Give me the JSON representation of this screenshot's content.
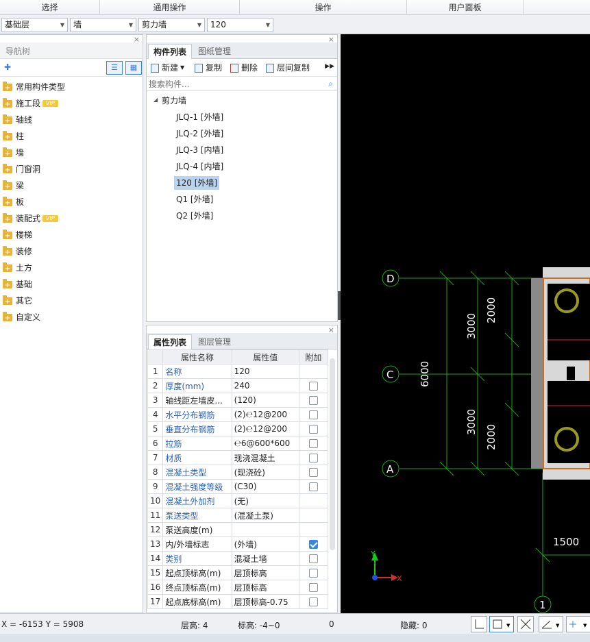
{
  "ribbon": [
    "选择",
    "通用操作",
    "操作",
    "用户面板"
  ],
  "selectors": {
    "floor": "基础层",
    "category": "墙",
    "type": "剪力墙",
    "component": "120"
  },
  "nav": {
    "title": "导航树",
    "items": [
      {
        "label": "常用构件类型",
        "vip": false
      },
      {
        "label": "施工段",
        "vip": true
      },
      {
        "label": "轴线",
        "vip": false
      },
      {
        "label": "柱",
        "vip": false
      },
      {
        "label": "墙",
        "vip": false
      },
      {
        "label": "门窗洞",
        "vip": false
      },
      {
        "label": "梁",
        "vip": false
      },
      {
        "label": "板",
        "vip": false
      },
      {
        "label": "装配式",
        "vip": true
      },
      {
        "label": "楼梯",
        "vip": false
      },
      {
        "label": "装修",
        "vip": false
      },
      {
        "label": "土方",
        "vip": false
      },
      {
        "label": "基础",
        "vip": false
      },
      {
        "label": "其它",
        "vip": false
      },
      {
        "label": "自定义",
        "vip": false
      }
    ],
    "vip_label": "VIP"
  },
  "components": {
    "tabs": [
      "构件列表",
      "图纸管理"
    ],
    "toolbar": {
      "new": "新建",
      "copy": "复制",
      "delete": "删除",
      "floor_copy": "层间复制"
    },
    "search_placeholder": "搜索构件...",
    "root": "剪力墙",
    "items": [
      "JLQ-1 [外墙]",
      "JLQ-2 [外墙]",
      "JLQ-3 [内墙]",
      "JLQ-4 [内墙]",
      "120 [外墙]",
      "Q1 [外墙]",
      "Q2 [外墙]"
    ],
    "selected_index": 4
  },
  "properties": {
    "tabs": [
      "属性列表",
      "图层管理"
    ],
    "headers": [
      "属性名称",
      "属性值",
      "附加"
    ],
    "rows": [
      {
        "n": "1",
        "name": "名称",
        "value": "120",
        "blue": true,
        "cb": null
      },
      {
        "n": "2",
        "name": "厚度(mm)",
        "value": "240",
        "blue": true,
        "cb": false
      },
      {
        "n": "3",
        "name": "轴线距左墙皮...",
        "value": "(120)",
        "blue": false,
        "cb": false
      },
      {
        "n": "4",
        "name": "水平分布钢筋",
        "value": "(2)℮12@200",
        "blue": true,
        "cb": false
      },
      {
        "n": "5",
        "name": "垂直分布钢筋",
        "value": "(2)℮12@200",
        "blue": true,
        "cb": false
      },
      {
        "n": "6",
        "name": "拉筋",
        "value": "℮6@600*600",
        "blue": true,
        "cb": false
      },
      {
        "n": "7",
        "name": "材质",
        "value": "现浇混凝土",
        "blue": true,
        "cb": false
      },
      {
        "n": "8",
        "name": "混凝土类型",
        "value": "(现浇砼)",
        "blue": true,
        "cb": false
      },
      {
        "n": "9",
        "name": "混凝土强度等级",
        "value": "(C30)",
        "blue": true,
        "cb": false
      },
      {
        "n": "10",
        "name": "混凝土外加剂",
        "value": "(无)",
        "blue": true,
        "cb": null
      },
      {
        "n": "11",
        "name": "泵送类型",
        "value": "(混凝土泵)",
        "blue": true,
        "cb": null
      },
      {
        "n": "12",
        "name": "泵送高度(m)",
        "value": "",
        "blue": false,
        "cb": null
      },
      {
        "n": "13",
        "name": "内/外墙标志",
        "value": "(外墙)",
        "blue": false,
        "cb": true
      },
      {
        "n": "14",
        "name": "类别",
        "value": "混凝土墙",
        "blue": true,
        "cb": false
      },
      {
        "n": "15",
        "name": "起点顶标高(m)",
        "value": "层顶标高",
        "blue": false,
        "cb": false
      },
      {
        "n": "16",
        "name": "终点顶标高(m)",
        "value": "层顶标高",
        "blue": false,
        "cb": false
      },
      {
        "n": "17",
        "name": "起点底标高(m)",
        "value": "层顶标高-0.75",
        "blue": false,
        "cb": false
      }
    ]
  },
  "canvas": {
    "axes": [
      "D",
      "C",
      "A",
      "1"
    ],
    "dims": [
      "3000",
      "2000",
      "6000",
      "3000",
      "2000",
      "1500"
    ],
    "ucs_x": "X",
    "ucs_y": "Y",
    "colors": {
      "grid": "#18a818",
      "wall": "#d0d0d0",
      "highlight": "#c87020",
      "ring": "#9a9a20"
    }
  },
  "status": {
    "coords": "X = -6153 Y = 5908",
    "floor_height": "层高:  4",
    "elevation": "标高:  -4~0",
    "count": "0",
    "hidden": "隐藏:  0"
  }
}
